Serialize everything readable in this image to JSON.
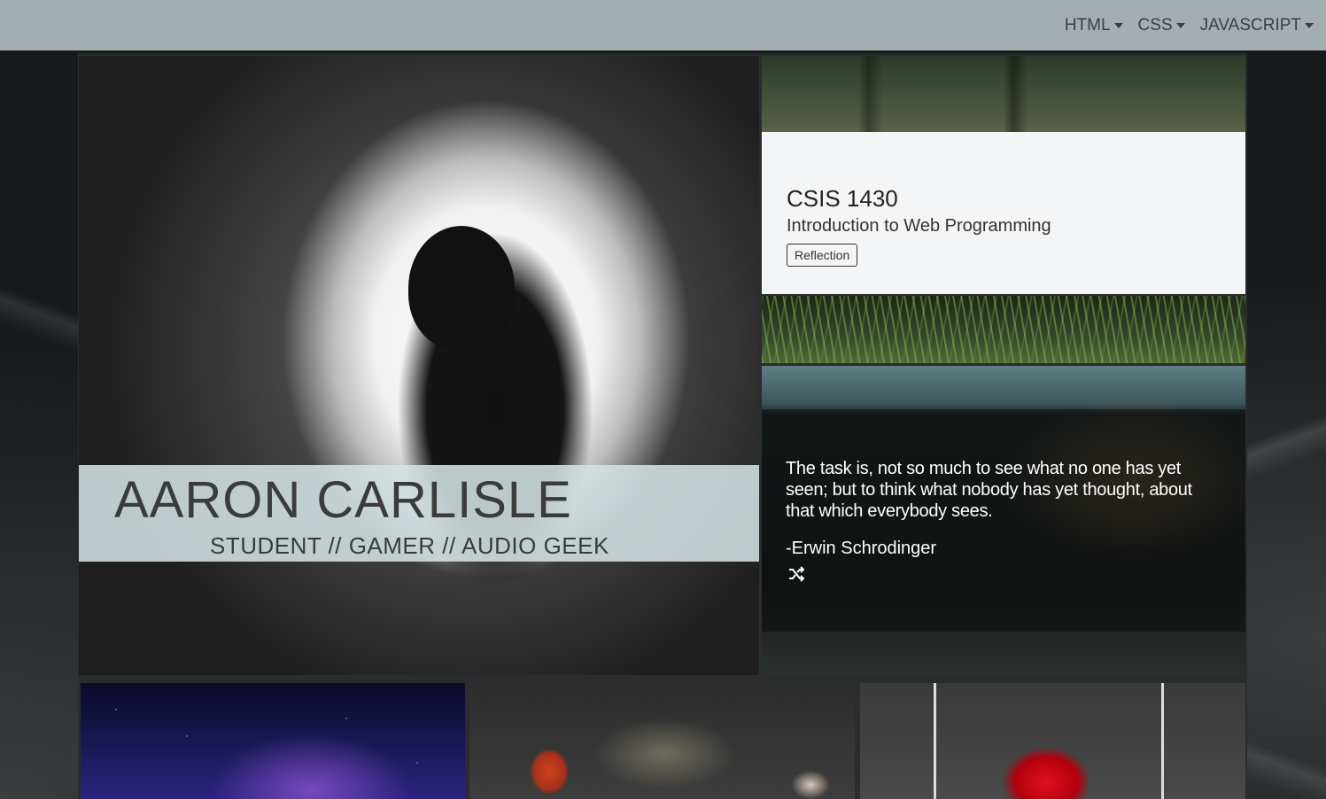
{
  "nav": {
    "items": [
      {
        "label": "HTML"
      },
      {
        "label": "CSS"
      },
      {
        "label": "JAVASCRIPT"
      }
    ]
  },
  "hero": {
    "name": "AARON CARLISLE",
    "tagline": "STUDENT // GAMER // AUDIO GEEK"
  },
  "course": {
    "title": "CSIS 1430",
    "subtitle": "Introduction to Web Programming",
    "button_label": "Reflection"
  },
  "quote": {
    "text": "The task is, not so much to see what no one has yet seen; but to think what nobody has yet thought, about that which everybody sees.",
    "author": "-Erwin Schrodinger",
    "shuffle_icon": "shuffle-icon"
  },
  "colors": {
    "navbar": "#a4adb0",
    "banner": "#d4e2e4",
    "card": "#f4f5f6"
  }
}
